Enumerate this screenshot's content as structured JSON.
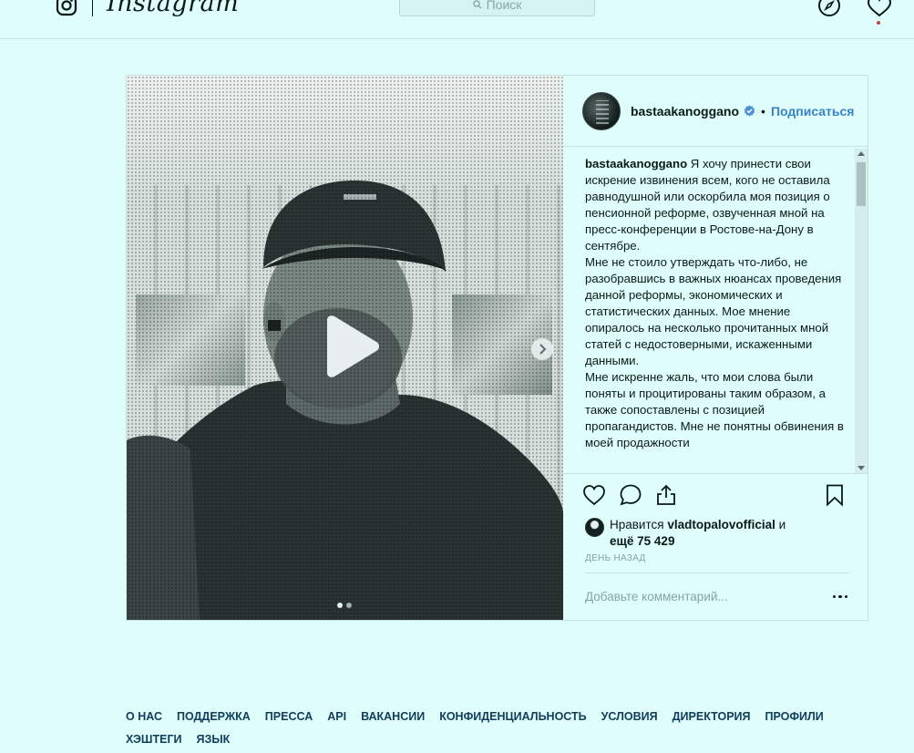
{
  "nav": {
    "logo_text": "Instagram",
    "search_placeholder": "Поиск"
  },
  "post": {
    "username": "bastaakanoggano",
    "follow_label": "Подписаться",
    "bullet": "•",
    "caption_user": "bastaakanoggano",
    "caption_paragraphs": [
      "Я хочу принести свои искрение извинения всем, кого не оставила равнодушной или оскорбила моя позиция о пенсионной реформе, озвученная мной на пресс-конференции в Ростове-на-Дону в сентябре.",
      "Мне не стоило утверждать что-либо, не разобравшись в важных нюансах проведения данной реформы, экономических и статистических данных. Мое мнение опиралось на несколько прочитанных мной статей с недостоверными, искаженными данными.",
      "Мне искренне жаль, что мои слова были поняты и процитированы таким образом, а также сопоставлены с позицией пропагандистов. Мне не понятны обвинения в моей продажности"
    ],
    "likes_prefix": "Нравится",
    "likes_user": "vladtopalovofficial",
    "likes_and": "и",
    "likes_more": "ещё 75 429",
    "timestamp": "день назад",
    "comment_placeholder": "Добавьте комментарий...",
    "carousel": {
      "slides": 2,
      "active": 1
    }
  },
  "footer": {
    "links": [
      "О НАС",
      "ПОДДЕРЖКА",
      "ПРЕССА",
      "API",
      "ВАКАНСИИ",
      "КОНФИДЕНЦИАЛЬНОСТЬ",
      "УСЛОВИЯ",
      "ДИРЕКТОРИЯ",
      "ПРОФИЛИ",
      "ХЭШТЕГИ",
      "ЯЗЫК"
    ]
  },
  "colors": {
    "background": "#defdfb",
    "link_blue": "#3a82c8",
    "footer_link": "#0f3d5c",
    "notification_dot": "#c3423a"
  },
  "icons": [
    "instagram-camera-icon",
    "search-icon",
    "compass-icon",
    "heart-icon",
    "verified-icon",
    "play-icon",
    "chevron-right-icon",
    "like-icon",
    "comment-icon",
    "share-icon",
    "bookmark-icon",
    "more-icon"
  ]
}
